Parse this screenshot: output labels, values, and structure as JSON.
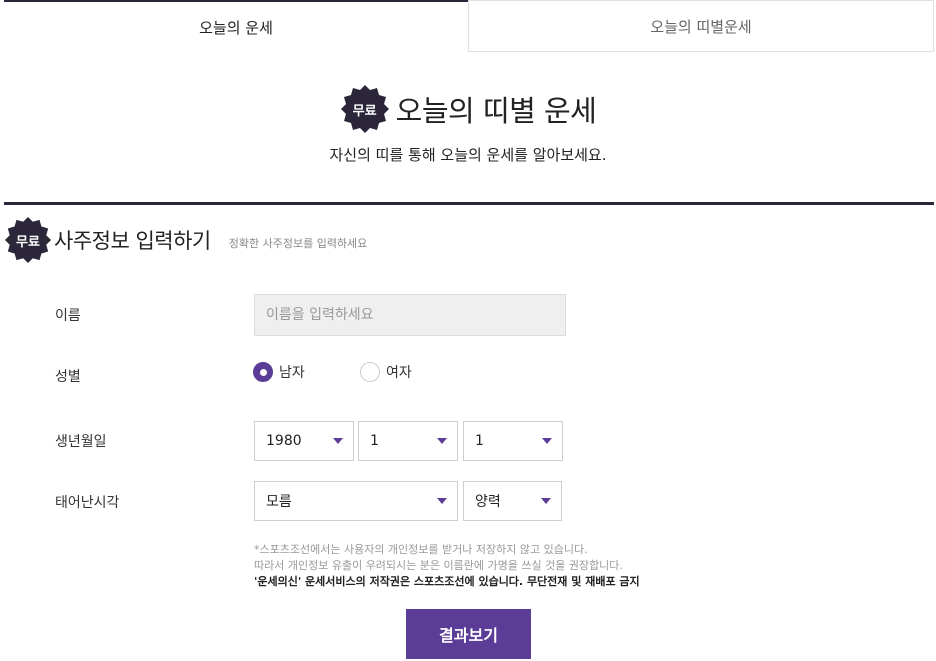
{
  "tabs": [
    {
      "label": "오늘의 운세",
      "active": true
    },
    {
      "label": "오늘의 띠별운세",
      "active": false
    }
  ],
  "badge_label": "무료",
  "hero": {
    "title": "오늘의 띠별 운세",
    "subtitle": "자신의 띠를 통해 오늘의 운세를 알아보세요."
  },
  "section": {
    "title": "사주정보 입력하기",
    "hint": "정확한 사주정보를 입력하세요"
  },
  "form": {
    "name_label": "이름",
    "name_placeholder": "이름을 입력하세요",
    "gender_label": "성별",
    "gender_options": [
      {
        "label": "남자",
        "selected": true
      },
      {
        "label": "여자",
        "selected": false
      }
    ],
    "birth_label": "생년월일",
    "birth_year": "1980",
    "birth_month": "1",
    "birth_day": "1",
    "time_label": "태어난시각",
    "time_value": "모름",
    "calendar_value": "양력"
  },
  "notice": {
    "line1": "*스포츠조선에서는 사용자의 개인정보를 받거나 저장하지 않고 있습니다.",
    "line2": "따라서 개인정보 유출이 우려되시는 분은 이름란에 가명을 쓰실 것을 권장합니다.",
    "line3": "'운세의신' 운세서비스의 저작권은 스포츠조선에 있습니다. 무단전재 및 재배포 금지"
  },
  "submit_label": "결과보기",
  "colors": {
    "accent": "#5b3d97",
    "dark": "#2b2639"
  }
}
